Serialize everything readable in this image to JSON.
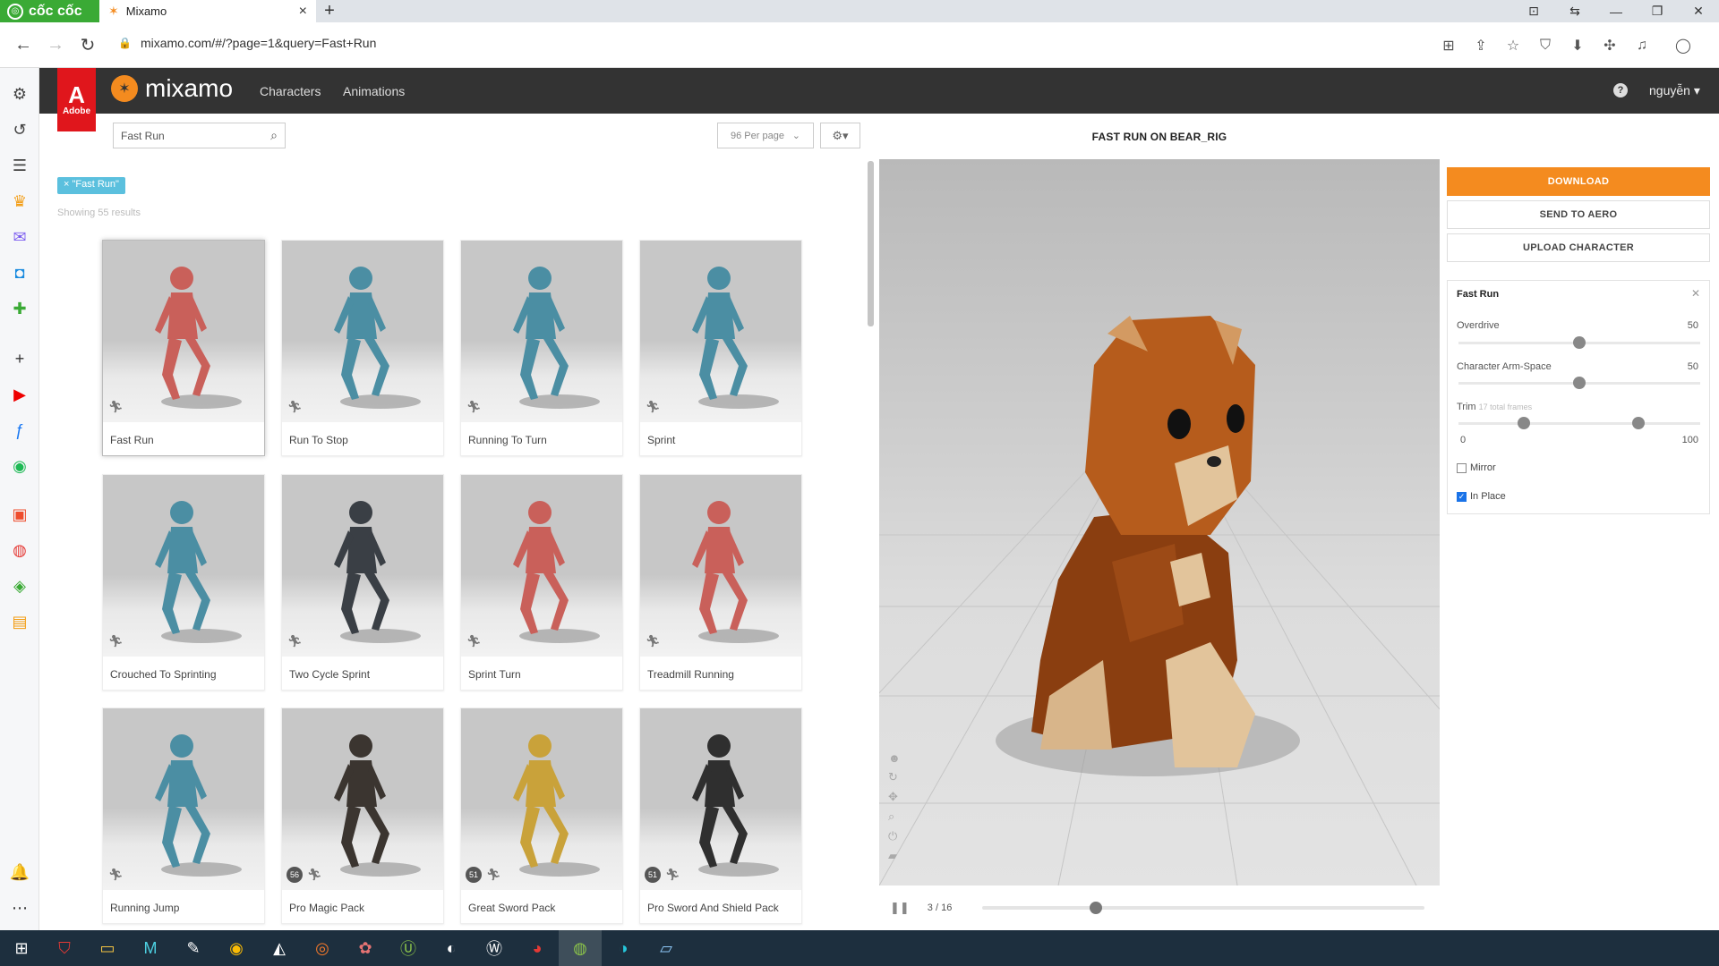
{
  "browser": {
    "brand": "cốc cốc",
    "tab_title": "Mixamo",
    "url": "mixamo.com/#/?page=1&query=Fast+Run"
  },
  "header": {
    "adobe_label": "Adobe",
    "logo_text": "mixamo",
    "nav": [
      "Characters",
      "Animations"
    ],
    "help": "?",
    "user": "nguyễn ▾"
  },
  "toolbar": {
    "search_value": "Fast Run",
    "per_page": "96 Per page",
    "filter_pill": "× \"Fast Run\"",
    "showing": "Showing 55 results"
  },
  "cards": [
    {
      "name": "Fast Run",
      "badge": "",
      "figure": "#c9605a"
    },
    {
      "name": "Run To Stop",
      "badge": "",
      "figure": "#4b8ea3"
    },
    {
      "name": "Running To Turn",
      "badge": "",
      "figure": "#4b8ea3"
    },
    {
      "name": "Sprint",
      "badge": "",
      "figure": "#4b8ea3"
    },
    {
      "name": "Crouched To Sprinting",
      "badge": "",
      "figure": "#4b8ea3"
    },
    {
      "name": "Two Cycle Sprint",
      "badge": "",
      "figure": "#3a3f45"
    },
    {
      "name": "Sprint Turn",
      "badge": "",
      "figure": "#c9605a"
    },
    {
      "name": "Treadmill Running",
      "badge": "",
      "figure": "#c9605a"
    },
    {
      "name": "Running Jump",
      "badge": "",
      "figure": "#4b8ea3"
    },
    {
      "name": "Pro Magic Pack",
      "badge": "56",
      "figure": "#3b3530"
    },
    {
      "name": "Great Sword Pack",
      "badge": "51",
      "figure": "#c9a23a"
    },
    {
      "name": "Pro Sword And Shield Pack",
      "badge": "51",
      "figure": "#2f2f2f"
    }
  ],
  "viewer": {
    "title": "FAST RUN ON BEAR_RIG",
    "frame": "3 / 16",
    "progress": 0.25
  },
  "actions": {
    "download": "DOWNLOAD",
    "send_to_aero": "SEND TO AERO",
    "upload_character": "UPLOAD CHARACTER"
  },
  "settings": {
    "title": "Fast Run",
    "overdrive_label": "Overdrive",
    "overdrive_value": "50",
    "armspace_label": "Character Arm-Space",
    "armspace_value": "50",
    "trim_label": "Trim",
    "trim_hint": "17 total frames",
    "trim_min": "0",
    "trim_max": "100",
    "mirror_label": "Mirror",
    "mirror_checked": false,
    "inplace_label": "In Place",
    "inplace_checked": true
  },
  "colors": {
    "accent": "#f48b1f",
    "adobe_red": "#e0161c",
    "header": "#333333"
  }
}
